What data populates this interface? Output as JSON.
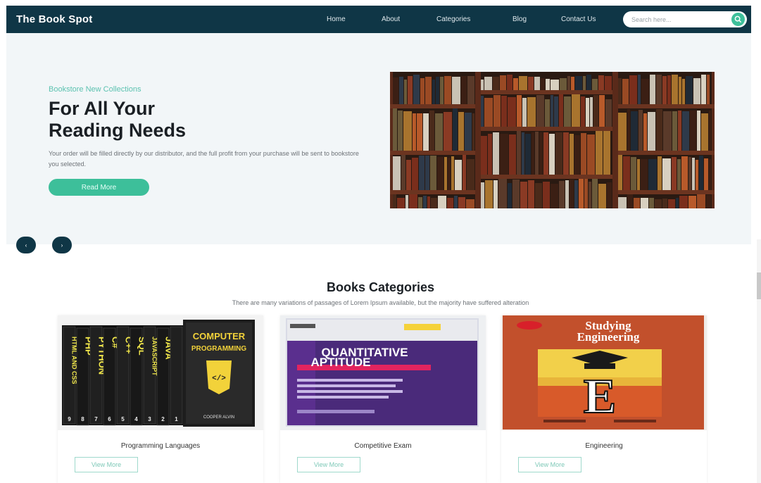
{
  "brand": "The Book Spot",
  "nav": {
    "items": [
      "Home",
      "About",
      "Categories",
      "Blog",
      "Contact Us"
    ]
  },
  "search": {
    "placeholder": "Search here..."
  },
  "hero": {
    "tag": "Bookstore New Collections",
    "title_line1": "For All Your",
    "title_line2": "Reading Needs",
    "text": "Your order will be filled directly by our distributor, and the full profit from your purchase will be sent to bookstore you selected.",
    "button": "Read More"
  },
  "carousel": {
    "prev": "‹",
    "next": "›"
  },
  "categories": {
    "title": "Books Categories",
    "subtitle": "There are many variations of passages of Lorem Ipsum available, but the majority have suffered alteration",
    "items": [
      {
        "name": "Programming Languages",
        "button": "View More",
        "cover_spines": [
          "HTML AND CSS",
          "PHP",
          "PYTHON",
          "C#",
          "C++",
          "SQL",
          "JAVASCRIPT",
          "JAVA"
        ],
        "cover_numbers": [
          "9",
          "8",
          "7",
          "6",
          "5",
          "4",
          "3",
          "2",
          "1"
        ],
        "cover_title": [
          "COMPUTER",
          "PROGRAMMING"
        ],
        "cover_author": "COOPER ALVIN"
      },
      {
        "name": "Competitive Exam",
        "button": "View More",
        "cover_title": [
          "QUANTITATIVE",
          "APTITUDE"
        ]
      },
      {
        "name": "Engineering",
        "button": "View More",
        "cover_title": [
          "Studying",
          "Engineering"
        ],
        "cover_letter": "E"
      }
    ]
  },
  "colors": {
    "nav_bg": "#0f3646",
    "accent": "#3dbf9a",
    "hero_bg": "#f2f6f8"
  }
}
